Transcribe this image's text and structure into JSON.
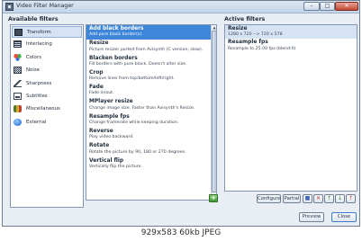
{
  "window": {
    "title": "Video Filter Manager",
    "minimize_glyph": "–",
    "maximize_glyph": "□",
    "close_glyph": "✕"
  },
  "available": {
    "heading": "Available filters",
    "categories": [
      {
        "label": "Transform",
        "icon": "transform-icon",
        "selected": true
      },
      {
        "label": "Interlacing",
        "icon": "interlacing-icon"
      },
      {
        "label": "Colors",
        "icon": "colors-icon"
      },
      {
        "label": "Noise",
        "icon": "noise-icon"
      },
      {
        "label": "Sharpness",
        "icon": "sharpness-icon"
      },
      {
        "label": "Subtitles",
        "icon": "subtitles-icon"
      },
      {
        "label": "Miscellaneous",
        "icon": "miscellaneous-icon"
      },
      {
        "label": "External",
        "icon": "external-icon"
      }
    ],
    "filters": [
      {
        "name": "Add black borders",
        "desc": "Add pure black border(s).",
        "selected": true
      },
      {
        "name": "Resize",
        "desc": "Picture resizer ported from Avisynth (C version, slow)."
      },
      {
        "name": "Blacken borders",
        "desc": "Fill borders with pure black. Doesn't alter size."
      },
      {
        "name": "Crop",
        "desc": "Remove lines from top/bottom/left/right."
      },
      {
        "name": "Fade",
        "desc": "Fade in/out."
      },
      {
        "name": "MPlayer resize",
        "desc": "Change image size. Faster than Avisynth's Resize."
      },
      {
        "name": "Resample fps",
        "desc": "Change framerate while keeping duration."
      },
      {
        "name": "Reverse",
        "desc": "Play video backward."
      },
      {
        "name": "Rotate",
        "desc": "Rotate the picture by 90, 180 or 270 degrees."
      },
      {
        "name": "Vertical flip",
        "desc": "Vertically flip the picture."
      }
    ],
    "add_glyph": "+"
  },
  "active": {
    "heading": "Active filters",
    "filters": [
      {
        "name": "Resize",
        "desc": "1280 x 720 --> 720 x 578",
        "selected": true
      },
      {
        "name": "Resample fps",
        "desc": "Resample to 25.00 fps (blend:0)"
      }
    ],
    "configure_label": "Configure",
    "partial_label": "Partial",
    "tools": [
      "■",
      "✕",
      "↑",
      "↓",
      "↑"
    ]
  },
  "footer": {
    "preview_label": "Preview",
    "close_label": "Close"
  },
  "caption": "929x583 60kb JPEG"
}
